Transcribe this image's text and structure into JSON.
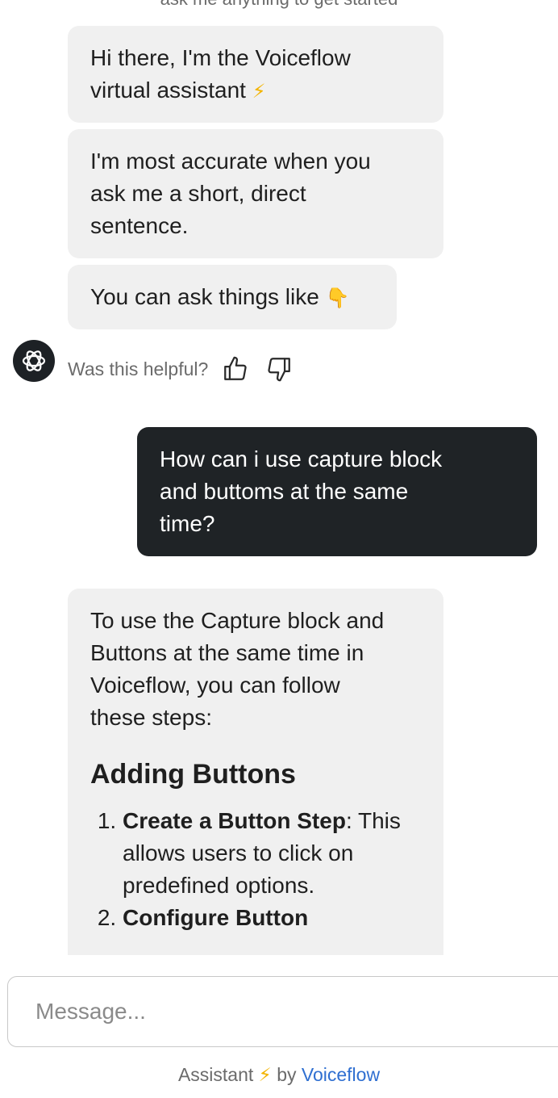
{
  "conversation": {
    "clipped_text": "ask me anything to get started",
    "greeting_line1": "Hi there, I'm the Voiceflow",
    "greeting_line2": "virtual assistant",
    "greeting_emoji": "⚡",
    "accuracy_line1": "I'm most accurate when you",
    "accuracy_line2": "ask me a short, direct",
    "accuracy_line3": "sentence.",
    "examples_text": "You can ask things like",
    "examples_emoji": "👇",
    "feedback_label": "Was this helpful?",
    "user_message_line1": "How can i use capture block",
    "user_message_line2": "and buttoms at the same",
    "user_message_line3": "time?",
    "answer_line1": "To use the Capture block and",
    "answer_line2": "Buttons at the same time in",
    "answer_line3": "Voiceflow, you can follow",
    "answer_line4": "these steps:",
    "answer_heading": "Adding Buttons",
    "steps": [
      {
        "title": "Create a Button Step",
        "sep": ":",
        "text": "This allows users to click on predefined options."
      },
      {
        "title": "Configure Button",
        "sep": "",
        "text": ""
      }
    ]
  },
  "composer": {
    "placeholder": "Message..."
  },
  "footer": {
    "prefix": "Assistant",
    "bolt": "⚡",
    "by": "by",
    "link": "Voiceflow"
  },
  "colors": {
    "bot_bubble": "#f0f0f0",
    "user_bubble": "#1f2326",
    "link": "#2f6fd1",
    "accent": "#f3b400"
  },
  "icons": [
    "voiceflow-logo-icon",
    "thumbs-up-icon",
    "thumbs-down-icon"
  ]
}
